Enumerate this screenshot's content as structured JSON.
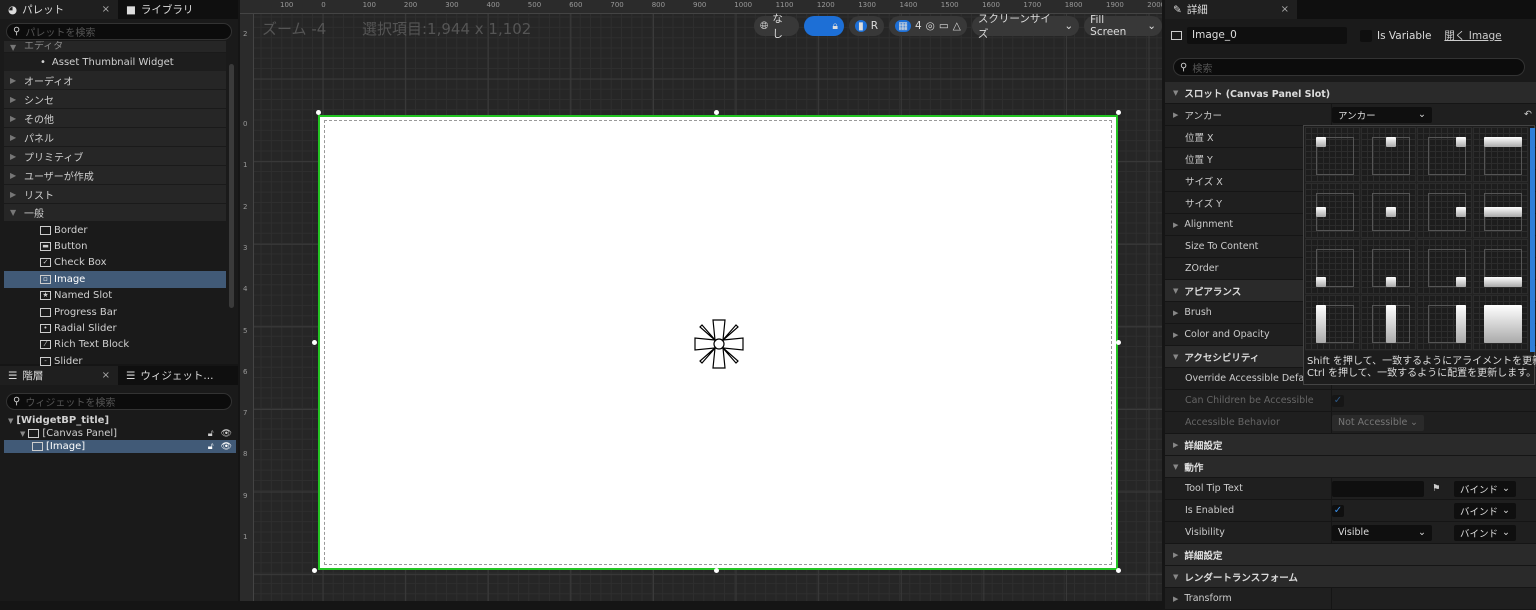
{
  "palette": {
    "tab_label": "パレット",
    "library_tab_label": "ライブラリ",
    "close": "×",
    "search_placeholder": "パレットを検索",
    "partial_top": "エディタ",
    "thumbnail_item": "Asset Thumbnail Widget",
    "categories": [
      "オーディオ",
      "シンセ",
      "その他",
      "パネル",
      "プリミティブ",
      "ユーザーが作成",
      "リスト"
    ],
    "open_category": "一般",
    "items": [
      {
        "label": "Border",
        "icon": "border-icon",
        "glyph": ""
      },
      {
        "label": "Button",
        "icon": "button-icon",
        "glyph": "▬"
      },
      {
        "label": "Check Box",
        "icon": "checkbox-icon",
        "glyph": "✓"
      },
      {
        "label": "Image",
        "icon": "image-icon",
        "glyph": "▫",
        "selected": true
      },
      {
        "label": "Named Slot",
        "icon": "named-slot-icon",
        "glyph": "★"
      },
      {
        "label": "Progress Bar",
        "icon": "progress-bar-icon",
        "glyph": ""
      },
      {
        "label": "Radial Slider",
        "icon": "radial-slider-icon",
        "glyph": "•"
      },
      {
        "label": "Rich Text Block",
        "icon": "rich-text-icon",
        "glyph": "⁄"
      },
      {
        "label": "Slider",
        "icon": "slider-icon",
        "glyph": "-"
      }
    ]
  },
  "hierarchy": {
    "tab_label": "階層",
    "widget_tab_label": "ウィジェット...",
    "close": "×",
    "search_placeholder": "ウィジェットを検索",
    "tree": [
      {
        "label": "[WidgetBP_title]",
        "depth": 0
      },
      {
        "label": "[Canvas Panel]",
        "depth": 1
      },
      {
        "label": "[Image]",
        "depth": 2,
        "selected": true
      }
    ]
  },
  "viewport": {
    "zoom_label": "ズーム -4",
    "selection_label": "選択項目:1,944 x 1,102",
    "ruler_top": [
      "100",
      "0",
      "100",
      "200",
      "300",
      "400",
      "500",
      "600",
      "700",
      "800",
      "900",
      "1000",
      "1100",
      "1200",
      "1300",
      "1400",
      "1500",
      "1600",
      "1700",
      "1800",
      "1900",
      "2000"
    ],
    "ruler_left": [
      "2",
      "0",
      "1",
      "2",
      "3",
      "4",
      "5",
      "6",
      "7",
      "8",
      "9",
      "1"
    ],
    "toolbar": {
      "localization": "なし",
      "respect_locks": "R",
      "grid_snap": "4",
      "screen_size": "スクリーンサイズ",
      "fill_screen": "Fill Screen"
    },
    "selection_color": "#22c422"
  },
  "details": {
    "tab_label": "詳細",
    "close": "×",
    "name_value": "Image_0",
    "is_variable_label": "Is Variable",
    "open_link": "開く Image",
    "search_placeholder": "検索",
    "slot_section": "スロット (Canvas Panel Slot)",
    "anchor_label": "アンカー",
    "anchor_value": "アンカー",
    "slot_rows": [
      "位置 X",
      "位置 Y",
      "サイズ X",
      "サイズ Y",
      "Alignment",
      "Size To Content",
      "ZOrder"
    ],
    "appearance_section": "アピアランス",
    "brush": "Brush",
    "color_opacity": "Color and Opacity",
    "accessibility_section": "アクセシビリティ",
    "override_label": "Override Accessible Defaults",
    "children_label": "Can Children be Accessible",
    "behavior_label": "Accessible Behavior",
    "behavior_value": "Not Accessible",
    "advanced": "詳細設定",
    "behavior_section": "動作",
    "tooltip_label": "Tool Tip Text",
    "enabled_label": "Is Enabled",
    "visibility_label": "Visibility",
    "visibility_value": "Visible",
    "bind": "バインド",
    "advanced2": "詳細設定",
    "render_section": "レンダートランスフォーム",
    "transform": "Transform",
    "anchor_hint_1": "Shift を押して、一致するようにアライメントを更新します。",
    "anchor_hint_2": "Ctrl を押して、一致するように配置を更新します。"
  }
}
